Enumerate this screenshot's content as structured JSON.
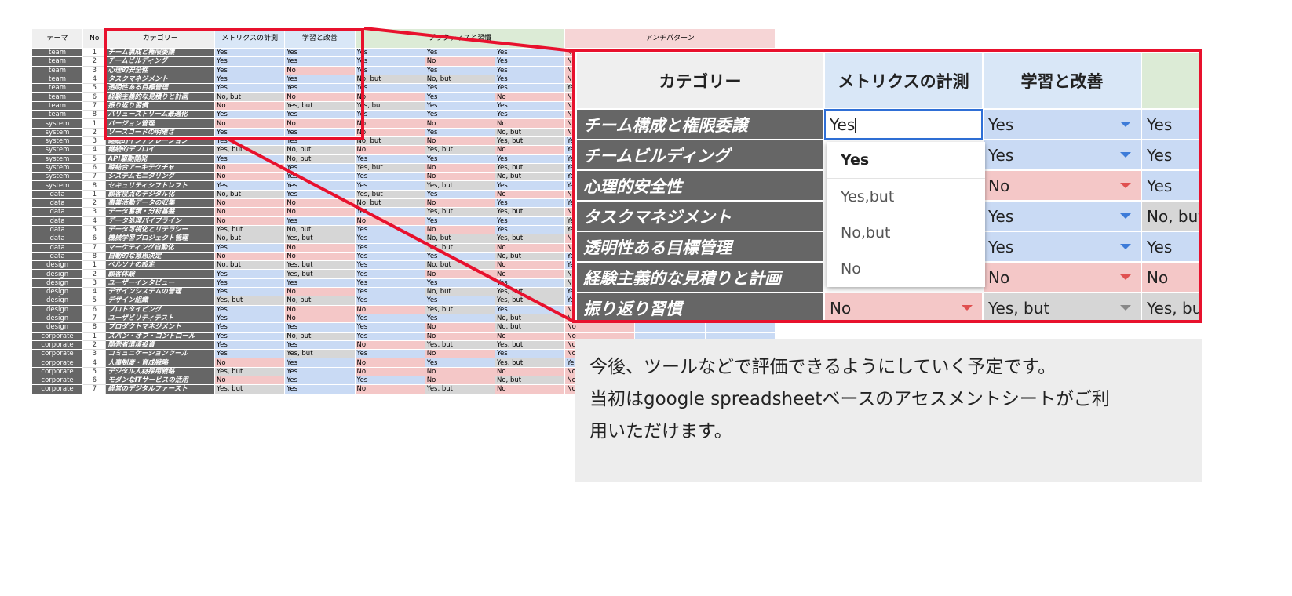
{
  "sheet": {
    "headers": {
      "theme": "テーマ",
      "no": "No",
      "category": "カテゴリー",
      "metrics": "メトリクスの計測",
      "learning": "学習と改善",
      "practice": "プラクティスと習慣",
      "anti": "アンチパターン"
    },
    "rows": [
      {
        "theme": "team",
        "no": "1",
        "category": "チーム構成と権限委譲",
        "values": [
          "Yes",
          "Yes",
          "Yes",
          "Yes",
          "Yes",
          "No",
          "",
          ""
        ]
      },
      {
        "theme": "team",
        "no": "2",
        "category": "チームビルディング",
        "values": [
          "Yes",
          "Yes",
          "Yes",
          "No",
          "Yes",
          "No",
          "",
          ""
        ]
      },
      {
        "theme": "team",
        "no": "3",
        "category": "心理的安全性",
        "values": [
          "Yes",
          "No",
          "Yes",
          "Yes",
          "Yes",
          "No",
          "",
          ""
        ]
      },
      {
        "theme": "team",
        "no": "4",
        "category": "タスクマネジメント",
        "values": [
          "Yes",
          "Yes",
          "No, but",
          "No, but",
          "Yes",
          "No",
          "",
          ""
        ]
      },
      {
        "theme": "team",
        "no": "5",
        "category": "透明性ある目標管理",
        "values": [
          "Yes",
          "Yes",
          "Yes",
          "Yes",
          "Yes",
          "Yes, but",
          "",
          ""
        ]
      },
      {
        "theme": "team",
        "no": "6",
        "category": "経験主義的な見積りと計画",
        "values": [
          "No, but",
          "No",
          "No",
          "Yes",
          "No",
          "No",
          "",
          ""
        ]
      },
      {
        "theme": "team",
        "no": "7",
        "category": "振り返り習慣",
        "values": [
          "No",
          "Yes, but",
          "Yes, but",
          "Yes",
          "Yes",
          "No",
          "",
          ""
        ]
      },
      {
        "theme": "team",
        "no": "8",
        "category": "バリューストリーム最適化",
        "values": [
          "Yes",
          "Yes",
          "Yes",
          "Yes",
          "Yes",
          "No",
          "",
          ""
        ]
      },
      {
        "theme": "system",
        "no": "1",
        "category": "バージョン管理",
        "values": [
          "No",
          "No",
          "No",
          "No",
          "No",
          "No",
          "",
          ""
        ]
      },
      {
        "theme": "system",
        "no": "2",
        "category": "ソースコードの明確さ",
        "values": [
          "Yes",
          "Yes",
          "No",
          "Yes",
          "No, but",
          "No",
          "",
          ""
        ]
      },
      {
        "theme": "system",
        "no": "3",
        "category": "継続的インテグレーション",
        "values": [
          "Yes",
          "Yes",
          "No, but",
          "No",
          "Yes, but",
          "Yes",
          "",
          ""
        ]
      },
      {
        "theme": "system",
        "no": "4",
        "category": "継続的デプロイ",
        "values": [
          "Yes, but",
          "No, but",
          "No",
          "Yes, but",
          "No",
          "Yes",
          "",
          ""
        ]
      },
      {
        "theme": "system",
        "no": "5",
        "category": "API駆動開発",
        "values": [
          "Yes",
          "No, but",
          "Yes",
          "Yes",
          "Yes",
          "Yes",
          "",
          ""
        ]
      },
      {
        "theme": "system",
        "no": "6",
        "category": "疎結合アーキテクチャ",
        "values": [
          "No",
          "Yes",
          "Yes, but",
          "No",
          "Yes, but",
          "Yes",
          "",
          ""
        ]
      },
      {
        "theme": "system",
        "no": "7",
        "category": "システムモニタリング",
        "values": [
          "No",
          "Yes",
          "Yes",
          "No",
          "No, but",
          "Yes",
          "",
          ""
        ]
      },
      {
        "theme": "system",
        "no": "8",
        "category": "セキュリティシフトレフト",
        "values": [
          "Yes",
          "Yes",
          "Yes",
          "Yes, but",
          "Yes",
          "Yes",
          "",
          ""
        ]
      },
      {
        "theme": "data",
        "no": "1",
        "category": "顧客接点のデジタル化",
        "values": [
          "No, but",
          "Yes",
          "Yes, but",
          "Yes",
          "No",
          "No",
          "",
          ""
        ]
      },
      {
        "theme": "data",
        "no": "2",
        "category": "事業活動データの収集",
        "values": [
          "No",
          "No",
          "No, but",
          "No",
          "Yes",
          "Yes",
          "",
          ""
        ]
      },
      {
        "theme": "data",
        "no": "3",
        "category": "データ蓄積・分析基盤",
        "values": [
          "No",
          "No",
          "Yes",
          "Yes, but",
          "Yes, but",
          "No",
          "",
          ""
        ]
      },
      {
        "theme": "data",
        "no": "4",
        "category": "データ処理パイプライン",
        "values": [
          "No",
          "Yes",
          "No",
          "Yes",
          "Yes",
          "Yes, but",
          "",
          ""
        ]
      },
      {
        "theme": "data",
        "no": "5",
        "category": "データ可視化とリテラシー",
        "values": [
          "Yes, but",
          "No, but",
          "Yes",
          "No",
          "Yes",
          "Yes, but",
          "",
          ""
        ]
      },
      {
        "theme": "data",
        "no": "6",
        "category": "機械学習プロジェクト管理",
        "values": [
          "No, but",
          "Yes, but",
          "Yes",
          "No, but",
          "Yes, but",
          "No",
          "",
          ""
        ]
      },
      {
        "theme": "data",
        "no": "7",
        "category": "マーケティング自動化",
        "values": [
          "Yes",
          "No",
          "Yes",
          "Yes, but",
          "No",
          "No",
          "Yes, but",
          "Yes, but"
        ]
      },
      {
        "theme": "data",
        "no": "8",
        "category": "自動的な意思決定",
        "values": [
          "No",
          "No",
          "Yes",
          "Yes",
          "No, but",
          "Yes",
          "",
          ""
        ]
      },
      {
        "theme": "design",
        "no": "1",
        "category": "ペルソナの設定",
        "values": [
          "No, but",
          "Yes, but",
          "Yes",
          "No, but",
          "No",
          "Yes",
          "",
          ""
        ]
      },
      {
        "theme": "design",
        "no": "2",
        "category": "顧客体験",
        "values": [
          "Yes",
          "Yes, but",
          "Yes",
          "No",
          "No",
          "No, but",
          "",
          ""
        ]
      },
      {
        "theme": "design",
        "no": "3",
        "category": "ユーザーインタビュー",
        "values": [
          "Yes",
          "Yes",
          "Yes",
          "Yes",
          "Yes",
          "No, but",
          "",
          ""
        ]
      },
      {
        "theme": "design",
        "no": "4",
        "category": "デザインシステムの管理",
        "values": [
          "Yes",
          "No",
          "Yes",
          "No, but",
          "Yes, but",
          "Yes",
          "",
          ""
        ]
      },
      {
        "theme": "design",
        "no": "5",
        "category": "デザイン組織",
        "values": [
          "Yes, but",
          "No, but",
          "Yes",
          "Yes",
          "Yes, but",
          "Yes",
          "",
          ""
        ]
      },
      {
        "theme": "design",
        "no": "6",
        "category": "プロトタイピング",
        "values": [
          "Yes",
          "No",
          "No",
          "Yes, but",
          "Yes",
          "No",
          "",
          ""
        ]
      },
      {
        "theme": "design",
        "no": "7",
        "category": "ユーザビリティテスト",
        "values": [
          "Yes",
          "No",
          "Yes",
          "Yes",
          "No, but",
          "No",
          "",
          ""
        ]
      },
      {
        "theme": "design",
        "no": "8",
        "category": "プロダクトマネジメント",
        "values": [
          "Yes",
          "Yes",
          "Yes",
          "No",
          "No, but",
          "No",
          "",
          ""
        ]
      },
      {
        "theme": "corporate",
        "no": "1",
        "category": "スパン・オブ・コントロール",
        "values": [
          "Yes",
          "No, but",
          "Yes",
          "No",
          "No",
          "No",
          "",
          ""
        ]
      },
      {
        "theme": "corporate",
        "no": "2",
        "category": "開発者環境投資",
        "values": [
          "Yes",
          "Yes",
          "No",
          "Yes, but",
          "Yes, but",
          "No",
          "",
          ""
        ]
      },
      {
        "theme": "corporate",
        "no": "3",
        "category": "コミュニケーションツール",
        "values": [
          "Yes",
          "Yes, but",
          "Yes",
          "No",
          "Yes",
          "No",
          "No",
          "No"
        ]
      },
      {
        "theme": "corporate",
        "no": "4",
        "category": "人事制度・育成戦略",
        "values": [
          "No",
          "Yes",
          "No",
          "Yes",
          "Yes, but",
          "Yes",
          "No",
          "No"
        ]
      },
      {
        "theme": "corporate",
        "no": "5",
        "category": "デジタル人材採用戦略",
        "values": [
          "Yes, but",
          "Yes",
          "No",
          "No",
          "No",
          "No",
          "No",
          "No"
        ]
      },
      {
        "theme": "corporate",
        "no": "6",
        "category": "モダンなITサービスの活用",
        "values": [
          "No",
          "Yes",
          "Yes",
          "No",
          "No, but",
          "No",
          "Yes",
          "Yes"
        ]
      },
      {
        "theme": "corporate",
        "no": "7",
        "category": "経営のデジタルファースト",
        "values": [
          "Yes, but",
          "Yes",
          "No",
          "Yes, but",
          "No",
          "No",
          "No",
          "No"
        ]
      }
    ]
  },
  "zoom": {
    "headers": {
      "category": "カテゴリー",
      "metrics": "メトリクスの計測",
      "learning": "学習と改善",
      "practice": ""
    },
    "rows": [
      {
        "category": "チーム構成と権限委譲",
        "metrics": "Yes",
        "learning": "Yes",
        "practice": "Yes"
      },
      {
        "category": "チームビルディング",
        "metrics": "",
        "learning": "Yes",
        "practice": "Yes"
      },
      {
        "category": "心理的安全性",
        "metrics": "",
        "learning": "No",
        "practice": "Yes"
      },
      {
        "category": "タスクマネジメント",
        "metrics": "",
        "learning": "Yes",
        "practice": "No, but"
      },
      {
        "category": "透明性ある目標管理",
        "metrics": "",
        "learning": "Yes",
        "practice": "Yes"
      },
      {
        "category": "経験主義的な見積りと計画",
        "metrics": "",
        "learning": "No",
        "practice": "No"
      },
      {
        "category": "振り返り習慣",
        "metrics": "No",
        "learning": "Yes, but",
        "practice": "Yes, bu"
      }
    ],
    "dropdown": [
      "Yes",
      "Yes,but",
      "No,but",
      "No"
    ]
  },
  "caption": {
    "line1": "今後、ツールなどで評価できるようにしていく予定です。",
    "line2": "当初はgoogle spreadsheetベースのアセスメントシートがご利",
    "line3": "用いただけます。"
  },
  "colors": {
    "highlight": "#e8112d",
    "yes": "#c9daf4",
    "no": "#f4c7c7",
    "but": "#d6d6d6",
    "category": "#666666"
  }
}
